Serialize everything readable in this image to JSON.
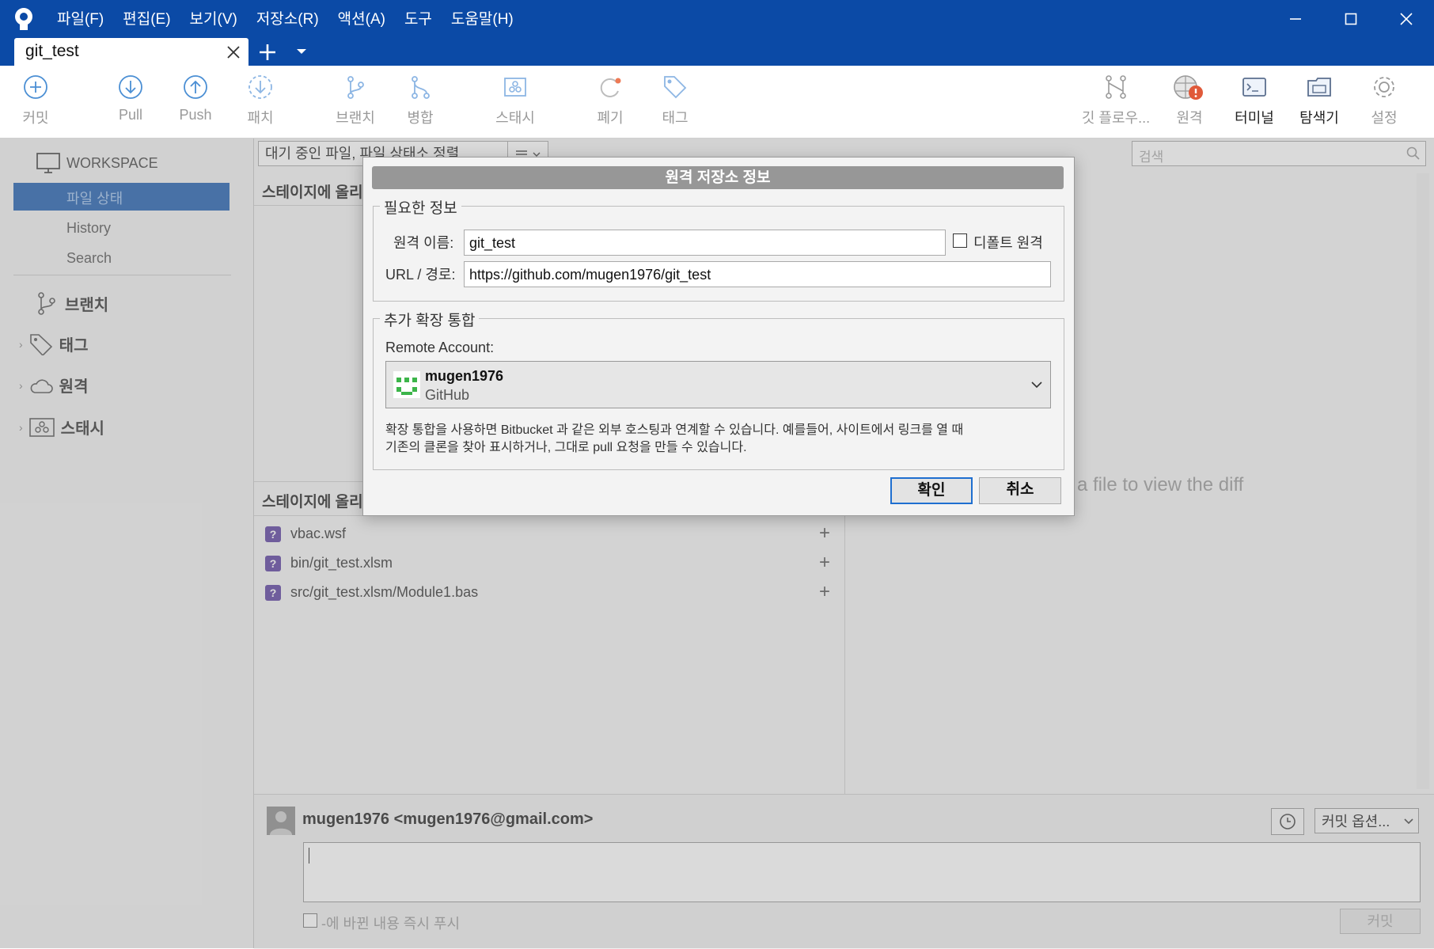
{
  "app": {
    "menu": [
      "파일(F)",
      "편집(E)",
      "보기(V)",
      "저장소(R)",
      "액션(A)",
      "도구",
      "도움말(H)"
    ],
    "tab_title": "git_test"
  },
  "toolbar": {
    "commit": "커밋",
    "pull": "Pull",
    "push": "Push",
    "patch": "패치",
    "branch": "브랜치",
    "merge": "병합",
    "stash": "스태시",
    "discard": "폐기",
    "tag": "태그",
    "gitflow": "깃 플로우...",
    "remote": "원격",
    "terminal": "터미널",
    "explorer": "탐색기",
    "settings": "설정"
  },
  "sidebar": {
    "workspace": "WORKSPACE",
    "file_status": "파일 상태",
    "history": "History",
    "search": "Search",
    "branches": "브랜치",
    "tags": "태그",
    "remotes": "원격",
    "stashes": "스태시"
  },
  "main": {
    "filter_dropdown": "대기 중인 파일, 파일 상태소 정렬",
    "search_placeholder": "검색",
    "staged_header": "스테이지에 올리",
    "unstaged_header": "스테이지에 올리",
    "files": [
      "vbac.wsf",
      "bin/git_test.xlsm",
      "src/git_test.xlsm/Module1.bas"
    ],
    "diff_hint": "a file to view the diff"
  },
  "commit_area": {
    "author": "mugen1976 <mugen1976@gmail.com>",
    "options": "커밋 옵션...",
    "push_checkbox": "-에 바뀐 내용 즉시 푸시",
    "commit_button": "커밋"
  },
  "dialog": {
    "title": "원격 저장소 정보",
    "required_legend": "필요한 정보",
    "remote_name_label": "원격 이름:",
    "remote_name_value": "git_test",
    "default_remote_label": "디폴트 원격",
    "url_label": "URL / 경로:",
    "url_value": "https://github.com/mugen1976/git_test",
    "extension_legend": "추가 확장 통합",
    "remote_account_label": "Remote Account:",
    "account_name": "mugen1976",
    "account_host": "GitHub",
    "description_line1": "확장 통합을 사용하면 Bitbucket 과 같은 외부 호스팅과 연계할 수 있습니다. 예를들어, 사이트에서 링크를 열 때",
    "description_line2": "기존의 클론을 찾아 표시하거나, 그대로 pull 요청을 만들 수 있습니다.",
    "ok": "확인",
    "cancel": "취소"
  },
  "colors": {
    "titlebar": "#0b4aa6",
    "selection": "#1f5fb0",
    "account_icon": "#3cb54a",
    "warning": "#e05a3a"
  }
}
